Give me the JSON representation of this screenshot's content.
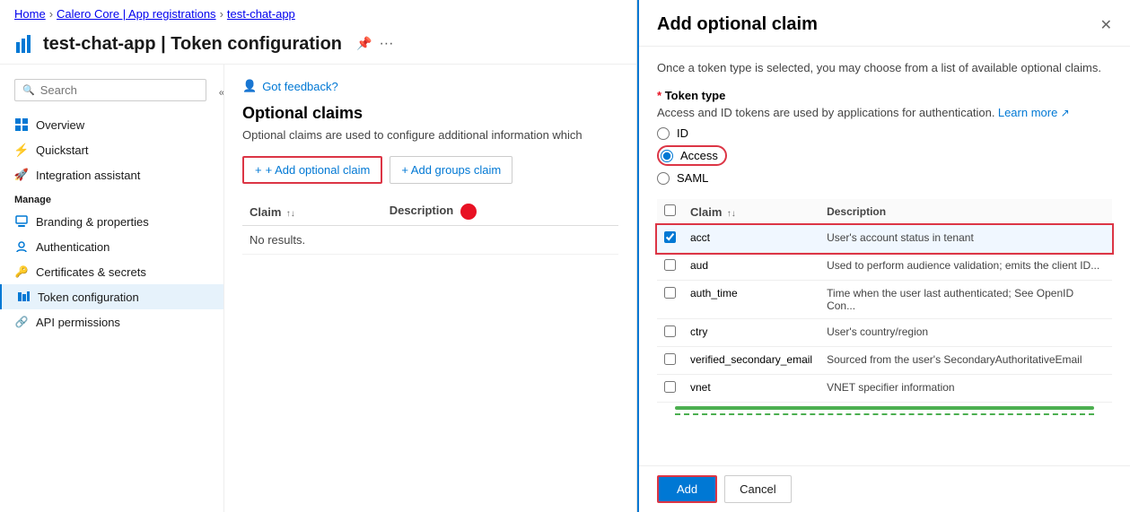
{
  "breadcrumb": {
    "home": "Home",
    "app_reg": "Calero Core | App registrations",
    "app": "test-chat-app",
    "sep": ">"
  },
  "header": {
    "title": "test-chat-app | Token configuration",
    "pin_label": "📌",
    "more_label": "···"
  },
  "sidebar": {
    "search_placeholder": "Search",
    "collapse_label": "«",
    "manage_label": "Manage",
    "items": [
      {
        "label": "Overview",
        "icon": "grid-icon",
        "active": false
      },
      {
        "label": "Quickstart",
        "icon": "lightning-icon",
        "active": false
      },
      {
        "label": "Integration assistant",
        "icon": "star-icon",
        "active": false
      },
      {
        "label": "Branding & properties",
        "icon": "branding-icon",
        "active": false
      },
      {
        "label": "Authentication",
        "icon": "auth-icon",
        "active": false
      },
      {
        "label": "Certificates & secrets",
        "icon": "cert-icon",
        "active": false
      },
      {
        "label": "Token configuration",
        "icon": "token-icon",
        "active": true
      },
      {
        "label": "API permissions",
        "icon": "api-icon",
        "active": false
      }
    ]
  },
  "content": {
    "feedback_label": "Got feedback?",
    "section_title": "Optional claims",
    "section_desc": "Optional claims are used to configure additional information which",
    "add_claim_label": "+ Add optional claim",
    "add_groups_label": "+ Add groups claim",
    "table": {
      "col_claim": "Claim",
      "col_description": "Description",
      "no_results": "No results."
    }
  },
  "modal": {
    "title": "Add optional claim",
    "close_label": "✕",
    "desc": "Once a token type is selected, you may choose from a list of available optional claims.",
    "token_type": {
      "label": "Token type",
      "required_star": "*",
      "desc": "Access and ID tokens are used by applications for authentication.",
      "learn_more": "Learn more",
      "options": [
        "ID",
        "Access",
        "SAML"
      ],
      "selected": "Access"
    },
    "claims_table": {
      "col_claim": "Claim",
      "col_description": "Description",
      "rows": [
        {
          "claim": "acct",
          "description": "User's account status in tenant",
          "checked": true,
          "highlighted": true
        },
        {
          "claim": "aud",
          "description": "Used to perform audience validation; emits the client ID...",
          "checked": false,
          "highlighted": false
        },
        {
          "claim": "auth_time",
          "description": "Time when the user last authenticated; See OpenID Con...",
          "checked": false,
          "highlighted": false
        },
        {
          "claim": "ctry",
          "description": "User's country/region",
          "checked": false,
          "highlighted": false
        },
        {
          "claim": "verified_secondary_email",
          "description": "Sourced from the user's SecondaryAuthoritativeEmail",
          "checked": false,
          "highlighted": false
        },
        {
          "claim": "vnet",
          "description": "VNET specifier information",
          "checked": false,
          "highlighted": false
        }
      ]
    },
    "add_label": "Add",
    "cancel_label": "Cancel"
  }
}
